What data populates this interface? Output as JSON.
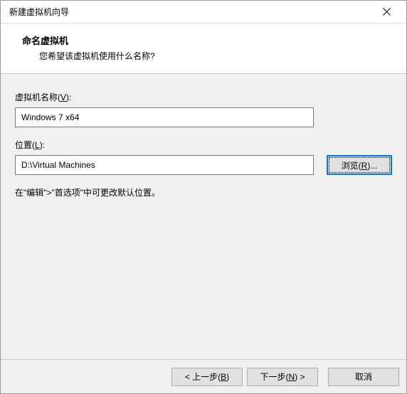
{
  "window": {
    "title": "新建虚拟机向导"
  },
  "header": {
    "title": "命名虚拟机",
    "subtitle": "您希望该虚拟机使用什么名称?"
  },
  "fields": {
    "vmname": {
      "label_prefix": "虚拟机名称(",
      "label_key": "V",
      "label_suffix": "):",
      "value": "Windows 7 x64"
    },
    "location": {
      "label_prefix": "位置(",
      "label_key": "L",
      "label_suffix": "):",
      "value": "D:\\Virtual Machines"
    },
    "browse": {
      "label_prefix": "浏览(",
      "label_key": "R",
      "label_suffix": ")..."
    }
  },
  "hint": "在\"编辑\">\"首选项\"中可更改默认位置。",
  "footer": {
    "back": {
      "prefix": "< 上一步(",
      "key": "B",
      "suffix": ")"
    },
    "next": {
      "prefix": "下一步(",
      "key": "N",
      "suffix": ") >"
    },
    "cancel": "取消"
  }
}
